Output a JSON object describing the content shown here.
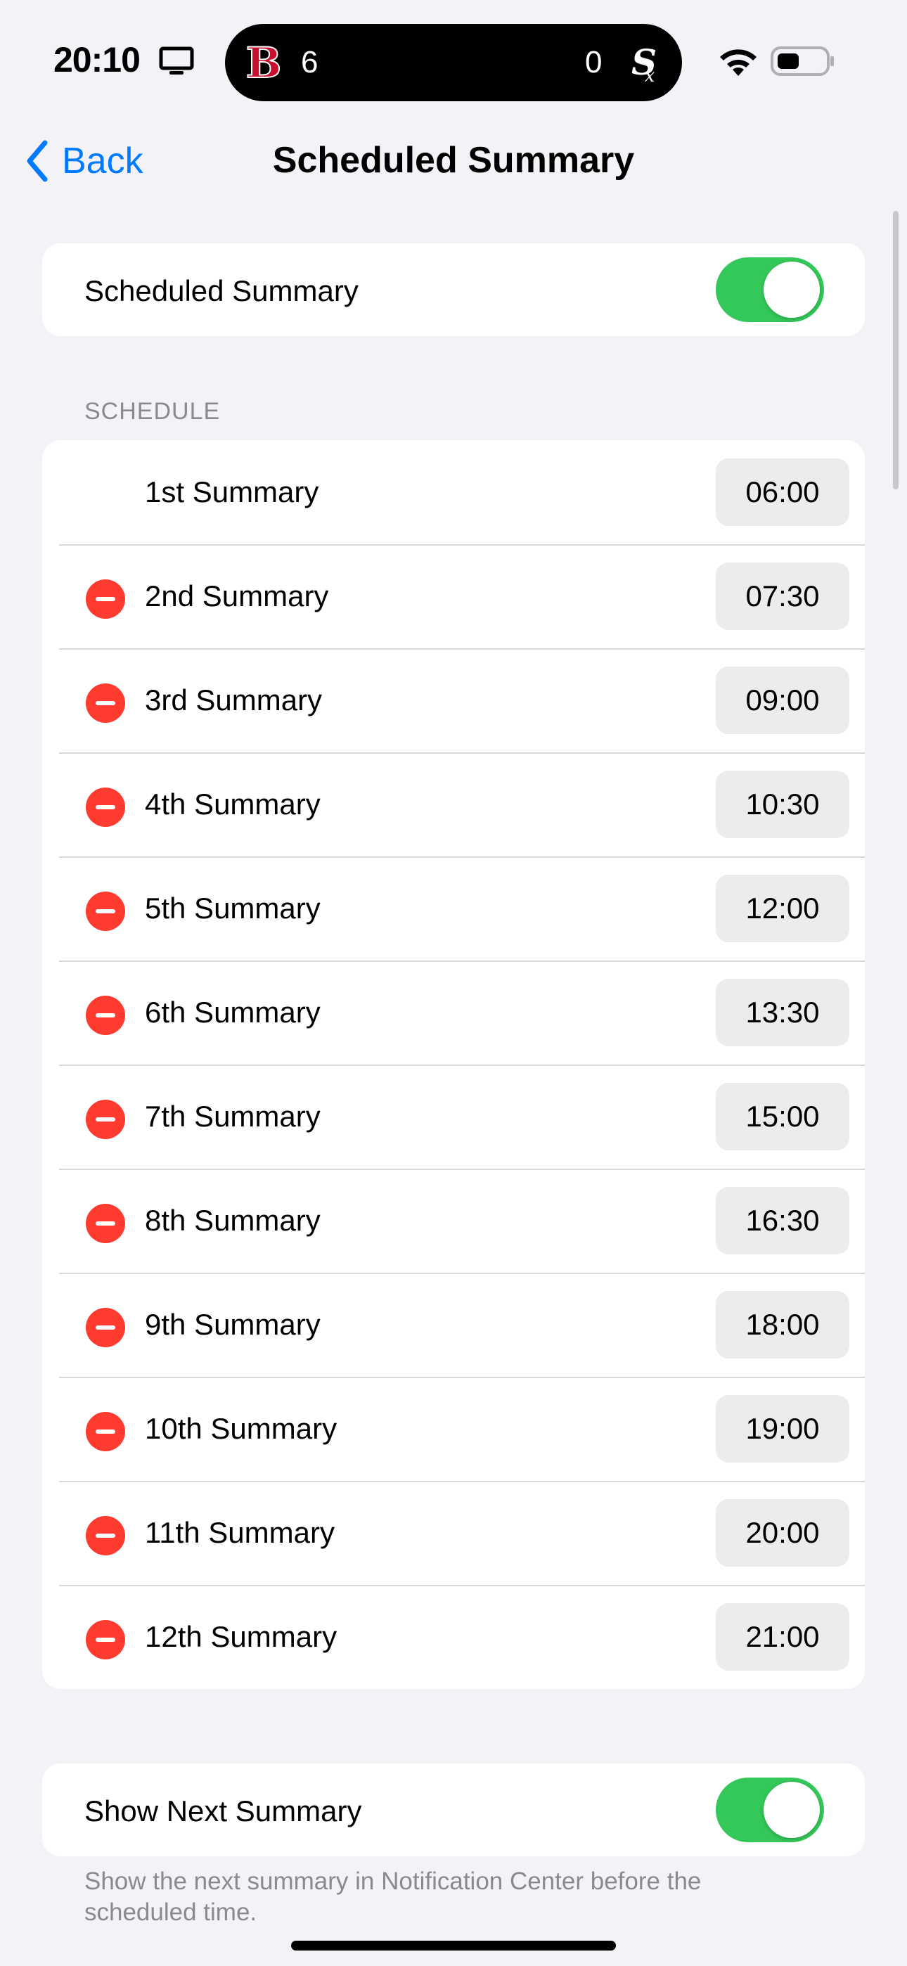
{
  "status_bar": {
    "time": "20:10",
    "live_activity": {
      "home_score": "6",
      "away_score": "0"
    }
  },
  "nav": {
    "back_label": "Back",
    "title": "Scheduled Summary"
  },
  "toggle_card": {
    "label": "Scheduled Summary",
    "enabled": true
  },
  "schedule": {
    "header": "SCHEDULE",
    "items": [
      {
        "label": "1st Summary",
        "time": "06:00",
        "removable": false
      },
      {
        "label": "2nd Summary",
        "time": "07:30",
        "removable": true
      },
      {
        "label": "3rd Summary",
        "time": "09:00",
        "removable": true
      },
      {
        "label": "4th Summary",
        "time": "10:30",
        "removable": true
      },
      {
        "label": "5th Summary",
        "time": "12:00",
        "removable": true
      },
      {
        "label": "6th Summary",
        "time": "13:30",
        "removable": true
      },
      {
        "label": "7th Summary",
        "time": "15:00",
        "removable": true
      },
      {
        "label": "8th Summary",
        "time": "16:30",
        "removable": true
      },
      {
        "label": "9th Summary",
        "time": "18:00",
        "removable": true
      },
      {
        "label": "10th Summary",
        "time": "19:00",
        "removable": true
      },
      {
        "label": "11th Summary",
        "time": "20:00",
        "removable": true
      },
      {
        "label": "12th Summary",
        "time": "21:00",
        "removable": true
      }
    ]
  },
  "next_summary": {
    "label": "Show Next Summary",
    "enabled": true,
    "footnote": "Show the next summary in Notification Center before the scheduled time."
  },
  "colors": {
    "accent": "#007aff",
    "toggle_on": "#34c759",
    "destructive": "#ff3b30",
    "background": "#f2f2f7"
  }
}
